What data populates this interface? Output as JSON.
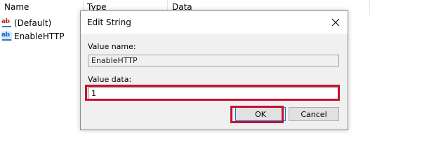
{
  "list": {
    "columns": [
      "Name",
      "Type",
      "Data"
    ],
    "rows": [
      {
        "label": "(Default)",
        "icon": "string-value-icon"
      },
      {
        "label": "EnableHTTP",
        "icon": "string-value-icon"
      }
    ]
  },
  "dialog": {
    "title": "Edit String",
    "value_name_label": "Value name:",
    "value_name": "EnableHTTP",
    "value_data_label": "Value data:",
    "value_data": "1",
    "ok_label": "OK",
    "cancel_label": "Cancel",
    "close_icon": "close-icon"
  },
  "colors": {
    "highlight": "#c8102e",
    "dialog_bg": "#f0f0f0"
  }
}
